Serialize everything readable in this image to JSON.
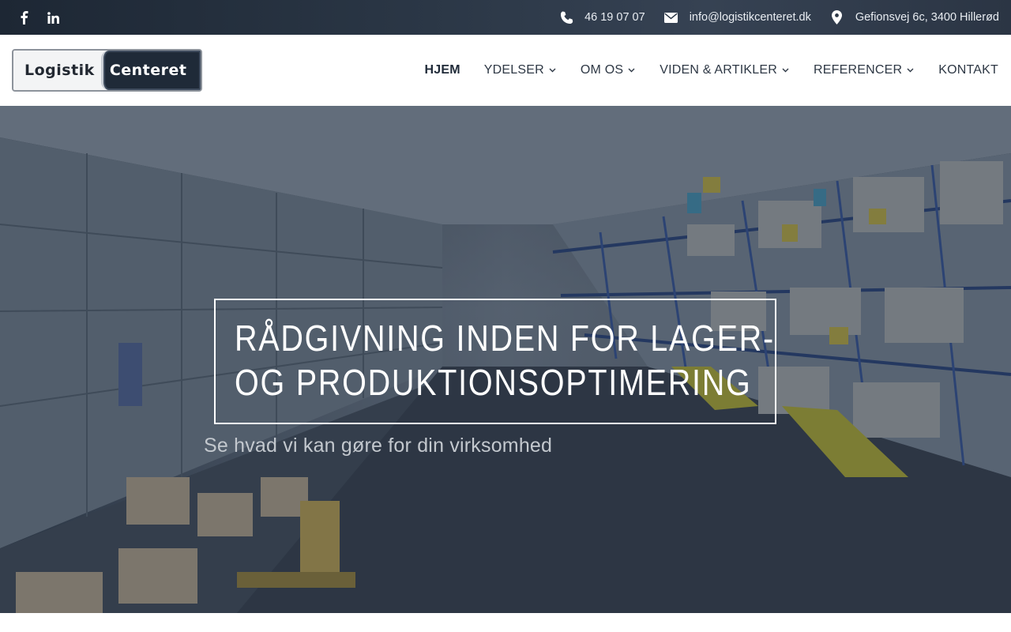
{
  "topbar": {
    "social": [
      {
        "icon": "facebook-icon"
      },
      {
        "icon": "linkedin-icon"
      }
    ],
    "phone": "46 19 07 07",
    "email": "info@logistikcenteret.dk",
    "address": "Gefionsvej 6c, 3400 Hillerød"
  },
  "header": {
    "logo_left": "Logistik",
    "logo_right": "Centeret",
    "nav": [
      {
        "label": "HJEM",
        "active": true,
        "dropdown": false
      },
      {
        "label": "YDELSER",
        "active": false,
        "dropdown": true
      },
      {
        "label": "OM OS",
        "active": false,
        "dropdown": true
      },
      {
        "label": "VIDEN & ARTIKLER",
        "active": false,
        "dropdown": true
      },
      {
        "label": "REFERENCER",
        "active": false,
        "dropdown": true
      },
      {
        "label": "KONTAKT",
        "active": false,
        "dropdown": false
      }
    ]
  },
  "hero": {
    "headline_line1": "RÅDGIVNING INDEN FOR LAGER-",
    "headline_line2": "OG PRODUKTIONSOPTIMERING",
    "subline": "Se hvad vi kan gøre for din virksomhed"
  },
  "colors": {
    "topbar_bg": "#2a3645",
    "nav_text": "#2e3845",
    "brand_dark": "#1f2a38",
    "hero_text": "#ffffff"
  }
}
